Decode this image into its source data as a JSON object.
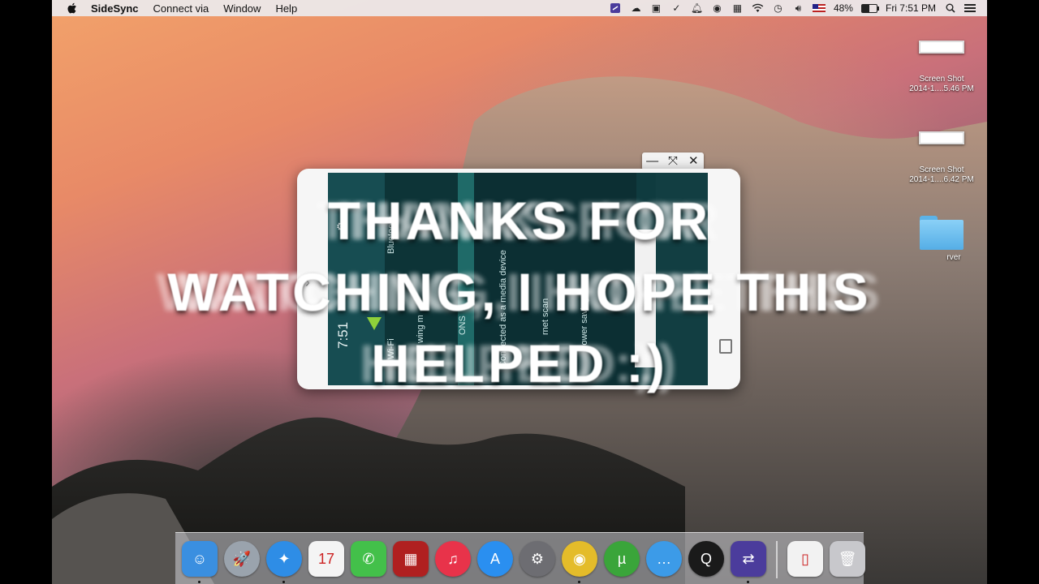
{
  "menubar": {
    "app_name": "SideSync",
    "menus": [
      "Connect via",
      "Window",
      "Help"
    ],
    "battery_percent": "48%",
    "battery_level": 0.48,
    "clock": "Fri 7:51 PM",
    "status_icons": [
      "sidesync-icon",
      "cloud-icon",
      "screen-share-icon",
      "check-icon",
      "bell-icon",
      "record-icon",
      "app-icon",
      "wifi-icon",
      "time-machine-icon",
      "volume-icon",
      "flag-icon"
    ]
  },
  "desktop": {
    "items": [
      {
        "label": "Screen Shot\n2014-1....5.46 PM"
      },
      {
        "label": "Screen Shot\n2014-1....6.42 PM"
      },
      {
        "label": "rver"
      }
    ]
  },
  "phone": {
    "time": "7:51",
    "texts": [
      "Wi-Fi",
      "Bluetooth",
      "wing m",
      "ONS",
      "Connected as a media device",
      "rnet scan",
      "Power saving"
    ]
  },
  "overlay": {
    "line1": "THANKS FOR",
    "line2": "WATCHING, I HOPE THIS",
    "line3": "HELPED :)"
  },
  "dock": {
    "apps": [
      {
        "name": "finder-icon",
        "glyph": "☺",
        "color": "#3a8fe0"
      },
      {
        "name": "launchpad-icon",
        "glyph": "🚀",
        "color": "#9aa3ad"
      },
      {
        "name": "safari-icon",
        "glyph": "✦",
        "color": "#2e8de6"
      },
      {
        "name": "calendar-icon",
        "glyph": "17",
        "color": "#f4f4f4"
      },
      {
        "name": "messages-icon",
        "glyph": "✆",
        "color": "#43c04a"
      },
      {
        "name": "photo-booth-icon",
        "glyph": "▦",
        "color": "#b02020"
      },
      {
        "name": "itunes-icon",
        "glyph": "♫",
        "color": "#e8334a"
      },
      {
        "name": "app-store-icon",
        "glyph": "A",
        "color": "#2a8ff0"
      },
      {
        "name": "system-preferences-icon",
        "glyph": "⚙",
        "color": "#6d6d72"
      },
      {
        "name": "chrome-icon",
        "glyph": "◉",
        "color": "#e4bc2a"
      },
      {
        "name": "utorrent-icon",
        "glyph": "µ",
        "color": "#3aa53a"
      },
      {
        "name": "chat-icon",
        "glyph": "…",
        "color": "#3c9be8"
      },
      {
        "name": "quicktime-icon",
        "glyph": "Q",
        "color": "#1a1a1a"
      },
      {
        "name": "sidesync-icon",
        "glyph": "⇄",
        "color": "#4b3c9c"
      },
      {
        "name": "document-icon",
        "glyph": "▯",
        "color": "#f2f2f2"
      },
      {
        "name": "trash-icon",
        "glyph": "🗑",
        "color": "#c8c8cc"
      }
    ]
  }
}
